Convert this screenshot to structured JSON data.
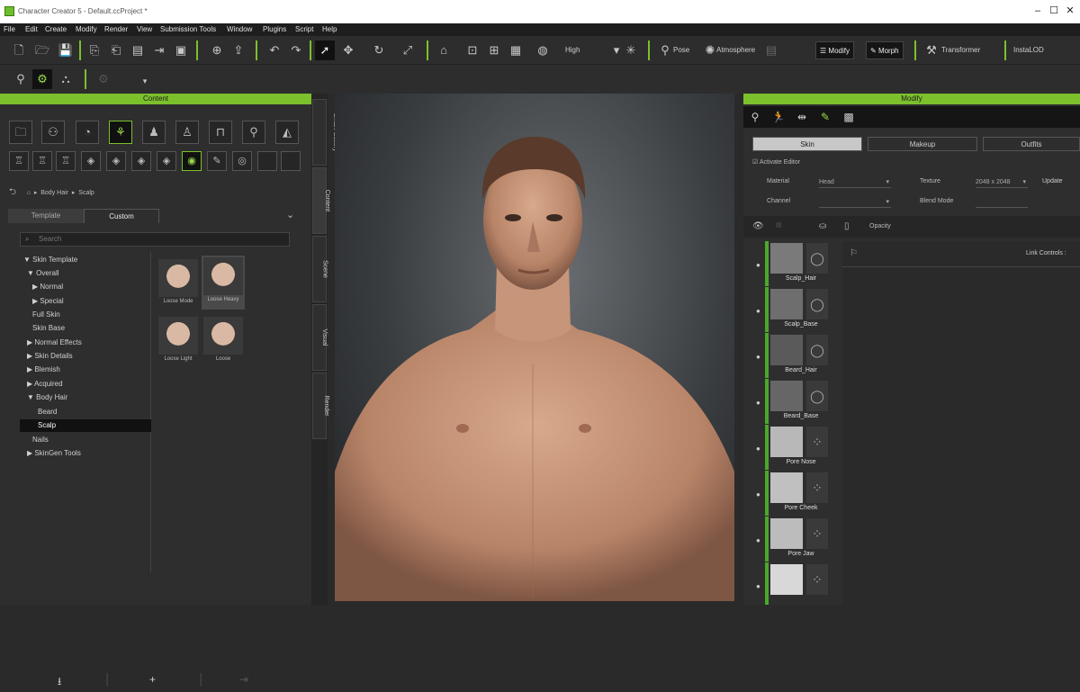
{
  "window": {
    "title": "Character Creator 5 - Default.ccProject *"
  },
  "menu": [
    "File",
    "Edit",
    "Create",
    "Modify",
    "Render",
    "View",
    "Submission Tools",
    "Window",
    "Plugins",
    "Script",
    "Help"
  ],
  "toolbar": {
    "quality": "High",
    "pose": "Pose",
    "atmosphere": "Atmosphere",
    "modify": "Modify",
    "morph": "Morph",
    "transformer": "Transformer",
    "insta_lod": "InstaLOD"
  },
  "content_panel": {
    "title": "Content",
    "breadcrumb": [
      "Body Hair",
      "Scalp"
    ],
    "tabs": [
      "Template",
      "Custom"
    ],
    "active_tab": "Custom",
    "search_placeholder": "Search",
    "tree": [
      {
        "label": "Skin Template",
        "arrow": "▼"
      },
      {
        "label": "Overall",
        "arrow": "▼"
      },
      {
        "label": "Normal",
        "arrow": "▶"
      },
      {
        "label": "Special",
        "arrow": "▶"
      },
      {
        "label": "Full Skin",
        "arrow": ""
      },
      {
        "label": "Skin Base",
        "arrow": ""
      },
      {
        "label": "Normal Effects",
        "arrow": "▶"
      },
      {
        "label": "Skin Details",
        "arrow": "▶"
      },
      {
        "label": "Blemish",
        "arrow": "▶"
      },
      {
        "label": "Acquired",
        "arrow": "▶"
      },
      {
        "label": "Body Hair",
        "arrow": "▼"
      },
      {
        "label": "Beard",
        "arrow": ""
      },
      {
        "label": "Scalp",
        "arrow": ""
      },
      {
        "label": "Nails",
        "arrow": ""
      },
      {
        "label": "SkinGen Tools",
        "arrow": "▶"
      }
    ],
    "thumbnails": [
      "Loose Mode",
      "Loose Heavy",
      "Loose Light",
      "Loose"
    ]
  },
  "vertical_tabs": [
    "Smart Gallery",
    "Content",
    "Scene",
    "Visual",
    "Render"
  ],
  "modify_panel": {
    "title": "Modify",
    "subtabs": [
      "Skin",
      "Makeup",
      "Outfits"
    ],
    "activate_editor": "Activate Editor",
    "material_label": "Material",
    "material_value": "Head",
    "texture_label": "Texture",
    "texture_value": "2048 x 2048",
    "update": "Update",
    "channel_label": "Channel",
    "blend_mode_label": "Blend Mode",
    "opacity_label": "Opacity",
    "link_controls": "Link Controls :",
    "layers": [
      "Scalp_Hair",
      "Scalp_Base",
      "Beard_Hair",
      "Beard_Base",
      "Pore Nose",
      "Pore Cheek",
      "Pore Jaw",
      ""
    ]
  }
}
